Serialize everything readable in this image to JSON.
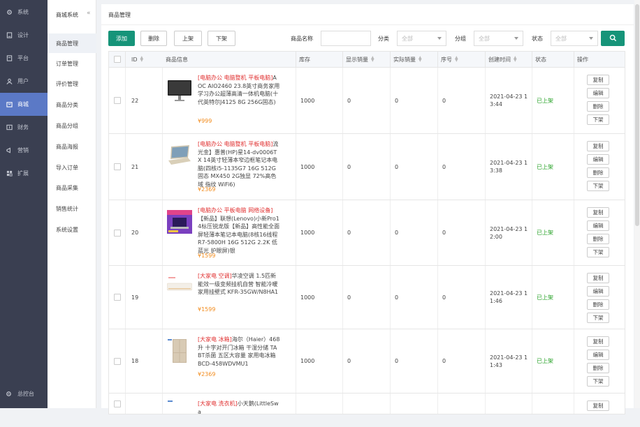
{
  "nav": {
    "items": [
      {
        "label": "系统",
        "icon": "gear-icon"
      },
      {
        "label": "设计",
        "icon": "design-icon"
      },
      {
        "label": "平台",
        "icon": "platform-icon"
      },
      {
        "label": "用户",
        "icon": "user-icon"
      },
      {
        "label": "商城",
        "icon": "mall-icon"
      },
      {
        "label": "财务",
        "icon": "finance-icon"
      },
      {
        "label": "营销",
        "icon": "marketing-icon"
      },
      {
        "label": "扩展",
        "icon": "extend-icon"
      }
    ],
    "active": "商城",
    "bottom": "总控台"
  },
  "subnav": {
    "title": "商城系统",
    "collapse": "«",
    "items": [
      "商品管理",
      "订单管理",
      "评价管理",
      "商品分类",
      "商品分组",
      "商品海报",
      "导入订单",
      "商品采集",
      "销售统计",
      "系统设置"
    ],
    "active": "商品管理"
  },
  "page": {
    "title": "商品管理"
  },
  "toolbar": {
    "add": "添加",
    "delete": "删除",
    "up": "上架",
    "down": "下架"
  },
  "filters": {
    "name_label": "商品名称",
    "category_label": "分类",
    "group_label": "分组",
    "status_label": "状态",
    "category_value": "全部",
    "group_value": "全部",
    "status_value": "全部"
  },
  "table": {
    "headers": {
      "id": "ID",
      "info": "商品信息",
      "stock": "库存",
      "shown_sales": "显示销量",
      "real_sales": "实际销量",
      "order": "序号",
      "created": "创建时间",
      "status": "状态",
      "ops": "操作"
    },
    "ops": {
      "copy": "复制",
      "edit": "编辑",
      "delete": "删除",
      "down": "下架"
    },
    "rows": [
      {
        "id": "22",
        "cat": "[电脑办公 电脑整机 平板电脑]",
        "name": "AOC AIO2460 23.8英寸商务家用学习办公超薄高清一体机电脑(十代英特尔J4125 8G 256G固态)",
        "price": "¥999",
        "stock": "1000",
        "shown": "0",
        "real": "0",
        "order": "0",
        "created": "2021-04-23 13:44",
        "status": "已上架",
        "thumb": "monitor"
      },
      {
        "id": "21",
        "cat": "[电脑办公 电脑整机 平板电脑]",
        "name": "流光金】惠普(HP)星14-dv0006TX 14英寸轻薄本窄边框笔记本电脑(四核i5-1135G7 16G 512G固态 MX450 2G独显 72%高色域 指纹 WiFi6)",
        "price": "¥2369",
        "stock": "1000",
        "shown": "0",
        "real": "0",
        "order": "0",
        "created": "2021-04-23 13:38",
        "status": "已上架",
        "thumb": "laptop"
      },
      {
        "id": "20",
        "cat": "[电脑办公 平板电脑 网络设备]",
        "name": "【新品】联想(Lenovo)小新Pro14标压锐龙版【新品】高性能全面屏轻薄本笔记本电脑(8核16线程R7-5800H 16G 512G 2.2K 低蓝光 护眼屏)银",
        "price": "¥1599",
        "stock": "1000",
        "shown": "0",
        "real": "0",
        "order": "0",
        "created": "2021-04-23 12:00",
        "status": "已上架",
        "thumb": "promo"
      },
      {
        "id": "19",
        "cat": "[大家电 空调]",
        "name": "华凌空调 1.5匹新能效一级变频挂机自营 智能冷暖 家用挂壁式 KFR-35GW/N8HA1",
        "price": "¥1599",
        "stock": "1000",
        "shown": "0",
        "real": "0",
        "order": "0",
        "created": "2021-04-23 11:46",
        "status": "已上架",
        "thumb": "ac"
      },
      {
        "id": "18",
        "cat": "[大家电 冰箱]",
        "name": "海尔（Haier）468升 十字对开门冰箱 干湿分储 TABT杀菌 五区大容量 家用电冰箱 BCD-458WDVMU1",
        "price": "¥2369",
        "stock": "1000",
        "shown": "0",
        "real": "0",
        "order": "0",
        "created": "2021-04-23 11:43",
        "status": "已上架",
        "thumb": "fridge"
      },
      {
        "id": "",
        "cat": "[大家电 洗衣机]",
        "name": "小天鹅(LittleSwa",
        "price": "",
        "stock": "",
        "shown": "",
        "real": "",
        "order": "",
        "created": "",
        "status": "",
        "thumb": "washer"
      }
    ]
  }
}
